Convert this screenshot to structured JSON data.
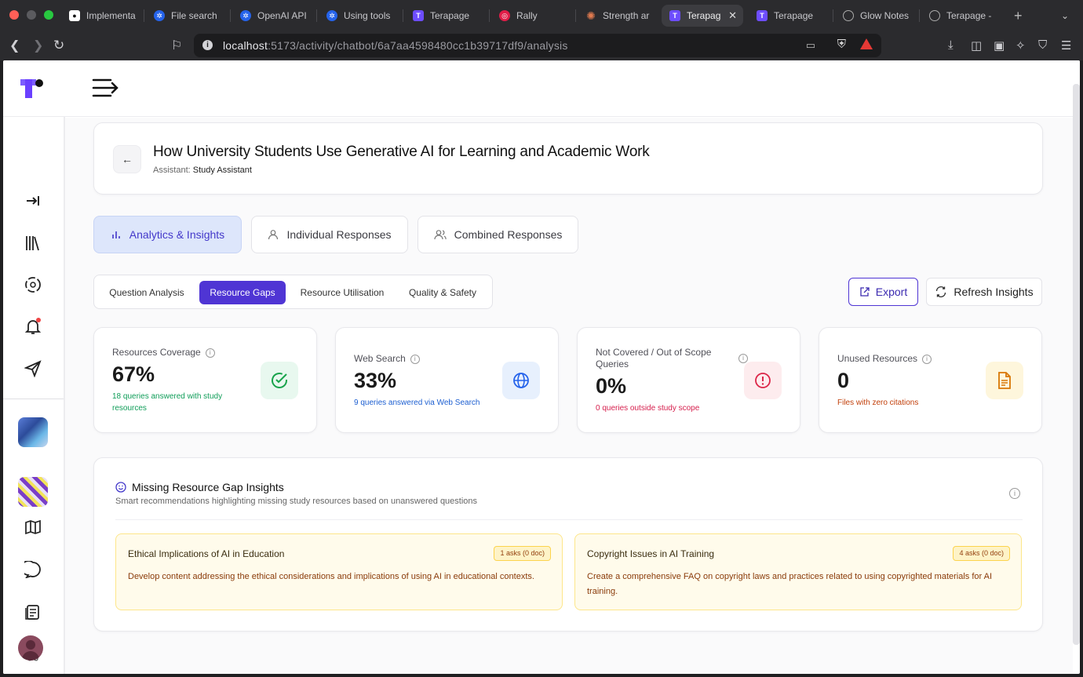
{
  "browser": {
    "tabs": [
      {
        "label": "Implementa",
        "icon": "github-icon"
      },
      {
        "label": "File search",
        "icon": "openai-icon"
      },
      {
        "label": "OpenAI API",
        "icon": "openai-icon"
      },
      {
        "label": "Using tools",
        "icon": "openai-icon"
      },
      {
        "label": "Terapage",
        "icon": "terapage-icon"
      },
      {
        "label": "Rally",
        "icon": "rally-icon"
      },
      {
        "label": "Strength ar",
        "icon": "claude-icon"
      },
      {
        "label": "Terapag",
        "icon": "terapage-icon",
        "active": true
      },
      {
        "label": "Terapage",
        "icon": "terapage-icon"
      },
      {
        "label": "Glow Notes",
        "icon": "globe-icon"
      },
      {
        "label": "Terapage -",
        "icon": "globe-icon"
      }
    ],
    "url_host": "localhost",
    "url_rest": ":5173/activity/chatbot/6a7aa4598480cc1b39717df9/analysis"
  },
  "header": {
    "title": "How University Students Use Generative AI for Learning and Academic Work",
    "assistant_label": "Assistant:",
    "assistant_name": "Study Assistant"
  },
  "main_tabs": [
    {
      "label": "Analytics & Insights",
      "icon": "bar-chart-icon",
      "active": true
    },
    {
      "label": "Individual Responses",
      "icon": "user-icon"
    },
    {
      "label": "Combined Responses",
      "icon": "users-icon"
    }
  ],
  "sub_tabs": [
    {
      "label": "Question Analysis"
    },
    {
      "label": "Resource Gaps",
      "active": true
    },
    {
      "label": "Resource Utilisation"
    },
    {
      "label": "Quality & Safety"
    }
  ],
  "actions": {
    "export_label": "Export",
    "refresh_label": "Refresh Insights"
  },
  "metrics": [
    {
      "label": "Resources Coverage",
      "value": "67%",
      "sub": "18 queries answered with study resources",
      "sub_color": "#0f9d58",
      "icon": "check-circle-icon",
      "icon_bg": "#e8f8ef",
      "icon_color": "#16a34a"
    },
    {
      "label": "Web Search",
      "value": "33%",
      "sub": "9 queries answered via Web Search",
      "sub_color": "#1d5fd1",
      "icon": "globe-icon",
      "icon_bg": "#e7f0fd",
      "icon_color": "#2563eb"
    },
    {
      "label": "Not Covered / Out of Scope Queries",
      "value": "0%",
      "sub": "0 queries outside study scope",
      "sub_color": "#d61f4d",
      "icon": "alert-circle-icon",
      "icon_bg": "#fdecee",
      "icon_color": "#dc2648"
    },
    {
      "label": "Unused Resources",
      "value": "0",
      "sub": "Files with zero citations",
      "sub_color": "#c2410c",
      "icon": "file-text-icon",
      "icon_bg": "#fef6dc",
      "icon_color": "#d97706"
    }
  ],
  "gaps_section": {
    "title": "Missing Resource Gap Insights",
    "subtitle": "Smart recommendations highlighting missing study resources based on unanswered questions",
    "items": [
      {
        "title": "Ethical Implications of AI in Education",
        "badge": "1 asks (0 doc)",
        "desc": "Develop content addressing the ethical considerations and implications of using AI in educational contexts."
      },
      {
        "title": "Copyright Issues in AI Training",
        "badge": "4 asks (0 doc)",
        "desc": "Create a comprehensive FAQ on copyright laws and practices related to using copyrighted materials for AI training."
      }
    ]
  },
  "colors": {
    "accent": "#4f35d4",
    "active_tab_bg": "#dde6fb"
  }
}
